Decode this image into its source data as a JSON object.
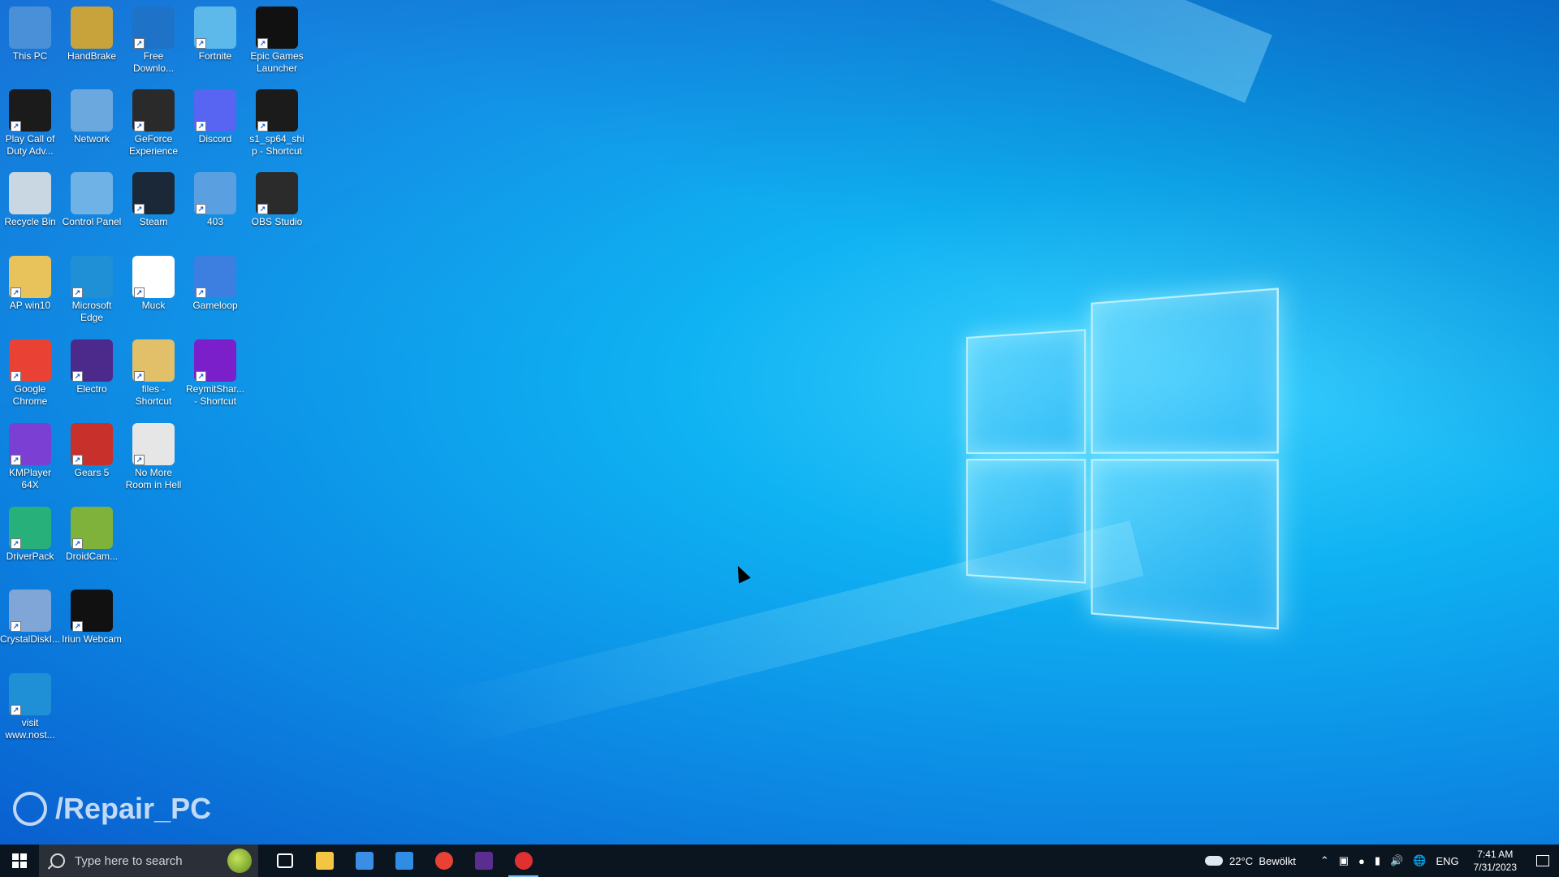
{
  "desktop_icons": [
    {
      "label": "This PC",
      "icon": "computer-icon",
      "color": "#4a90d9"
    },
    {
      "label": "HandBrake",
      "icon": "handbrake-pineapple-icon",
      "color": "#c8a23a"
    },
    {
      "label": "Free Downlo...",
      "icon": "free-download-manager-icon",
      "color": "#1e73c8"
    },
    {
      "label": "Fortnite",
      "icon": "fortnite-icon",
      "color": "#5db9ea"
    },
    {
      "label": "Epic Games Launcher",
      "icon": "epic-games-icon",
      "color": "#111111"
    },
    {
      "label": "Play Call of Duty Adv...",
      "icon": "call-of-duty-icon",
      "color": "#1b1b1b"
    },
    {
      "label": "Network",
      "icon": "network-globe-icon",
      "color": "#6aa8de"
    },
    {
      "label": "GeForce Experience",
      "icon": "geforce-icon",
      "color": "#2a2a2a"
    },
    {
      "label": "Discord",
      "icon": "discord-icon",
      "color": "#5865f2"
    },
    {
      "label": "s1_sp64_ship - Shortcut",
      "icon": "call-of-duty-icon",
      "color": "#1b1b1b"
    },
    {
      "label": "Recycle Bin",
      "icon": "recycle-bin-icon",
      "color": "#c9d7e3"
    },
    {
      "label": "Control Panel",
      "icon": "control-panel-icon",
      "color": "#6fb3e6"
    },
    {
      "label": "Steam",
      "icon": "steam-icon",
      "color": "#1b2838"
    },
    {
      "label": "403",
      "icon": "app-shield-icon",
      "color": "#5aa0e0"
    },
    {
      "label": "OBS Studio",
      "icon": "obs-icon",
      "color": "#2b2b2b"
    },
    {
      "label": "AP win10",
      "icon": "user-folder-icon",
      "color": "#e8c25a"
    },
    {
      "label": "Microsoft Edge",
      "icon": "edge-icon",
      "color": "#1f8fd6"
    },
    {
      "label": "Muck",
      "icon": "blank-file-icon",
      "color": "#ffffff"
    },
    {
      "label": "Gameloop",
      "icon": "gameloop-icon",
      "color": "#3c7fe0"
    },
    {
      "label": "Google Chrome",
      "icon": "chrome-icon",
      "color": "#e94235"
    },
    {
      "label": "Electro",
      "icon": "electro-icon",
      "color": "#4b2a8c"
    },
    {
      "label": "files - Shortcut",
      "icon": "folder-icon",
      "color": "#e2c06a"
    },
    {
      "label": "ReymitShar... - Shortcut",
      "icon": "reymit-icon",
      "color": "#7a1fc9"
    },
    {
      "label": "KMPlayer 64X",
      "icon": "kmplayer-icon",
      "color": "#7b3fd4"
    },
    {
      "label": "Gears 5",
      "icon": "gears-icon",
      "color": "#c8302c"
    },
    {
      "label": "No More Room in Hell",
      "icon": "no-more-room-icon",
      "color": "#e6e6e6"
    },
    {
      "label": "DriverPack",
      "icon": "driverpack-icon",
      "color": "#27b07a"
    },
    {
      "label": "DroidCam...",
      "icon": "droidcam-icon",
      "color": "#7fb23a"
    },
    {
      "label": "CrystalDiskI...",
      "icon": "crystaldisk-icon",
      "color": "#7fa6d6"
    },
    {
      "label": "Iriun Webcam",
      "icon": "webcam-icon",
      "color": "#111111"
    },
    {
      "label": "visit www.nost...",
      "icon": "edge-icon",
      "color": "#1f8fd6"
    }
  ],
  "watermark": "/Repair_PC",
  "taskbar": {
    "search_placeholder": "Type here to search",
    "pinned": [
      {
        "name": "task-view-icon",
        "color": "#ffffff"
      },
      {
        "name": "file-explorer-icon",
        "color": "#f4c542"
      },
      {
        "name": "microsoft-store-icon",
        "color": "#3a8ee6"
      },
      {
        "name": "mail-icon",
        "color": "#2f8de4"
      },
      {
        "name": "chrome-icon",
        "color": "#e94235"
      },
      {
        "name": "visual-studio-icon",
        "color": "#5c2d91"
      },
      {
        "name": "recorder-icon",
        "color": "#e03030"
      }
    ],
    "weather_temp": "22°C",
    "weather_text": "Bewölkt",
    "language": "ENG",
    "time": "7:41 AM",
    "date": "7/31/2023"
  }
}
